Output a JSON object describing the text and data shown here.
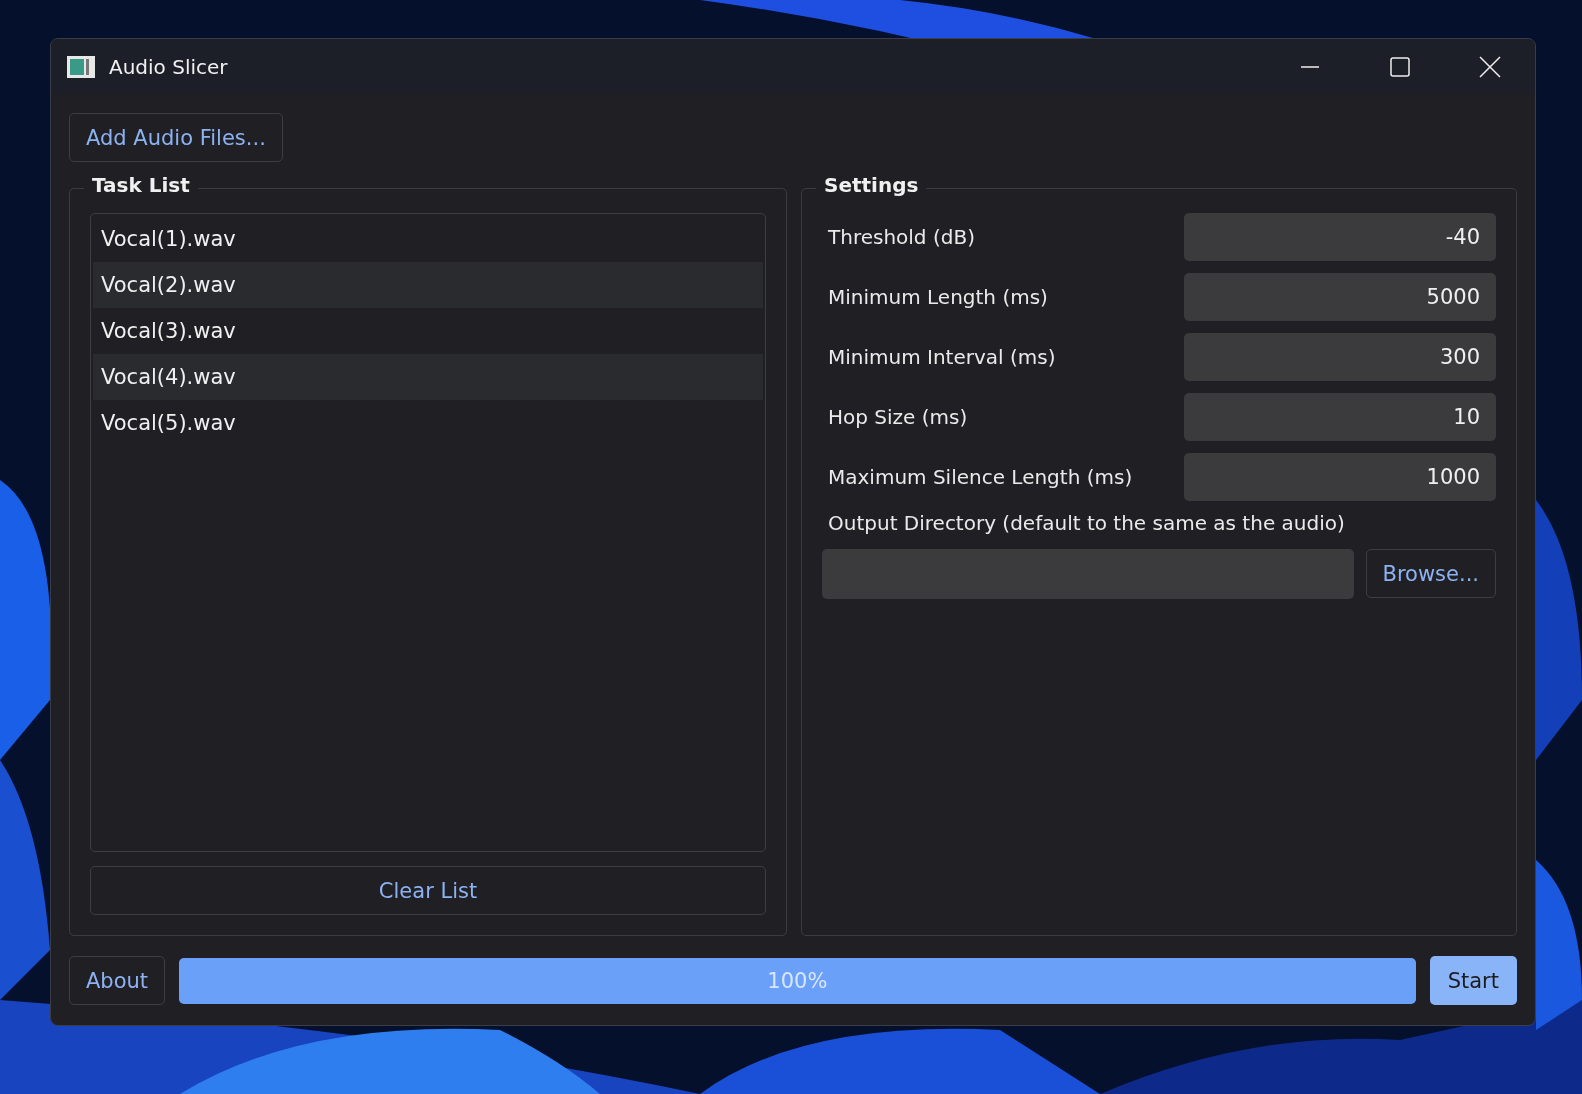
{
  "window": {
    "title": "Audio Slicer"
  },
  "add_button": "Add Audio Files...",
  "task_list": {
    "title": "Task List",
    "items": [
      "Vocal(1).wav",
      "Vocal(2).wav",
      "Vocal(3).wav",
      "Vocal(4).wav",
      "Vocal(5).wav"
    ],
    "clear_button": "Clear List"
  },
  "settings": {
    "title": "Settings",
    "fields": [
      {
        "label": "Threshold (dB)",
        "value": "-40"
      },
      {
        "label": "Minimum Length (ms)",
        "value": "5000"
      },
      {
        "label": "Minimum Interval (ms)",
        "value": "300"
      },
      {
        "label": "Hop Size (ms)",
        "value": "10"
      },
      {
        "label": "Maximum Silence Length (ms)",
        "value": "1000"
      }
    ],
    "output_label": "Output Directory (default to the same as the audio)",
    "browse_button": "Browse..."
  },
  "about_button": "About",
  "progress": {
    "level": 1.0,
    "text": "100%"
  },
  "start_button": "Start"
}
